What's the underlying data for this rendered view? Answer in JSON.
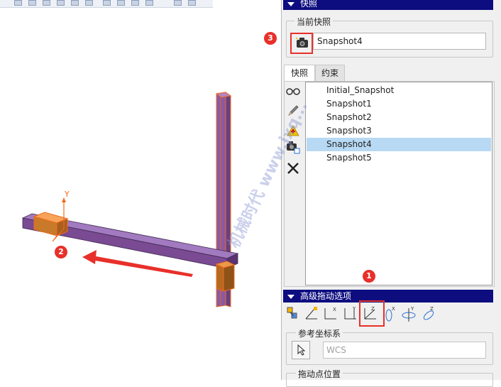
{
  "panel": {
    "snapshot_section_title": "快照",
    "current_snapshot_label": "当前快照",
    "current_snapshot_value": "Snapshot4",
    "tabs": [
      {
        "label": "快照",
        "active": true
      },
      {
        "label": "约束",
        "active": false
      }
    ],
    "snapshots": [
      {
        "label": "Initial_Snapshot",
        "selected": false
      },
      {
        "label": "Snapshot1",
        "selected": false
      },
      {
        "label": "Snapshot2",
        "selected": false
      },
      {
        "label": "Snapshot3",
        "selected": false
      },
      {
        "label": "Snapshot4",
        "selected": true
      },
      {
        "label": "Snapshot5",
        "selected": false
      }
    ],
    "side_tools": [
      "glasses-icon",
      "pencil-icon",
      "warning-add-icon",
      "camera-copy-icon",
      "delete-x-icon"
    ],
    "advanced_drag_title": "高级拖动选项",
    "drag_tools": [
      "drag-free-icon",
      "drag-plane-icon",
      "translate-x-icon",
      "translate-y-icon",
      "translate-z-icon",
      "rotate-x-icon",
      "rotate-y-icon",
      "rotate-z-icon"
    ],
    "ref_coord_label": "参考坐标系",
    "ref_coord_value": "WCS",
    "drag_point_label": "拖动点位置"
  },
  "viewport": {
    "axis_label": "Y"
  },
  "markers": [
    "1",
    "2",
    "3"
  ],
  "watermark": "机械时代 www.jxq...",
  "colors": {
    "accent_header": "#0d0d80",
    "selection": "#b7d9f4",
    "beam_purple": "#7a4a93",
    "highlight_orange": "#f26a1b",
    "marker_red": "#e8302a"
  }
}
